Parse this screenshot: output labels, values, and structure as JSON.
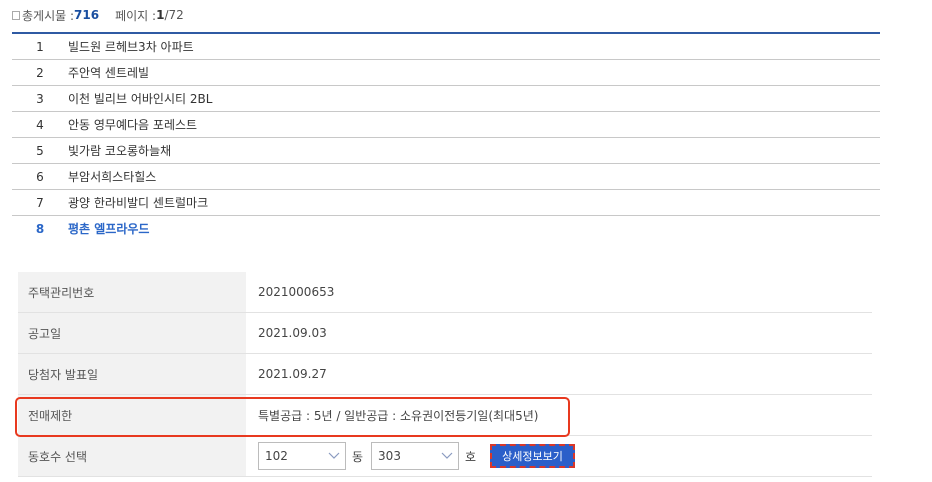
{
  "summary": {
    "total_label": "총게시물 : ",
    "total_value": "716",
    "page_label": "페이지 : ",
    "page_current": "1",
    "page_rest": "/72"
  },
  "list": [
    {
      "idx": "1",
      "name": "빌드원 르헤브3차 아파트"
    },
    {
      "idx": "2",
      "name": "주안역 센트레빌"
    },
    {
      "idx": "3",
      "name": "이천 빌리브 어바인시티 2BL"
    },
    {
      "idx": "4",
      "name": "안동 영무예다음 포레스트"
    },
    {
      "idx": "5",
      "name": "빛가람 코오롱하늘채"
    },
    {
      "idx": "6",
      "name": "부암서희스타힐스"
    },
    {
      "idx": "7",
      "name": "광양 한라비발디 센트럴마크"
    },
    {
      "idx": "8",
      "name": "평촌 엘프라우드"
    }
  ],
  "detail": {
    "mgmt_label": "주택관리번호",
    "mgmt_value": "2021000653",
    "notice_label": "공고일",
    "notice_value": "2021.09.03",
    "winner_label": "당첨자 발표일",
    "winner_value": "2021.09.27",
    "resale_label": "전매제한",
    "resale_value": "특별공급 : 5년 / 일반공급 : 소유권이전등기일(최대5년)",
    "unit_label": "동호수 선택",
    "dong_value": "102",
    "dong_unit": "동",
    "ho_value": "303",
    "ho_unit": "호",
    "detail_button": "상세정보보기"
  },
  "colors": {
    "accent": "#2b67c8",
    "highlight": "#e8391f",
    "button": "#2b5fc9"
  }
}
